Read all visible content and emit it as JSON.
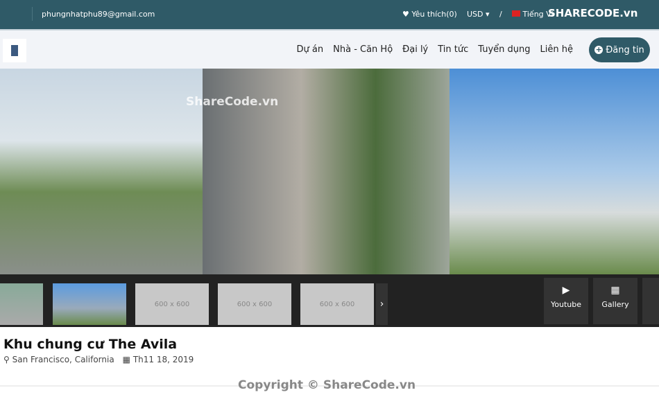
{
  "topbar": {
    "email": "phungnhatphu89@gmail.com",
    "wishlist": "Yêu thích(0)",
    "currency": "USD",
    "divider": "/",
    "language": "Tiếng Vi",
    "brand_watermark": "SHARECODE.vn"
  },
  "nav": {
    "items": [
      "Dự án",
      "Nhà - Căn Hộ",
      "Đại lý",
      "Tin tức",
      "Tuyển dụng",
      "Liên hệ"
    ],
    "post_button": "Đăng tin"
  },
  "hero": {
    "watermark": "ShareCode.vn"
  },
  "thumbnails": {
    "placeholders": [
      "600 x 600",
      "600 x 600",
      "600 x 600"
    ]
  },
  "media_buttons": [
    {
      "label": "Youtube",
      "icon": "youtube-icon"
    },
    {
      "label": "Gallery",
      "icon": "grid-icon"
    }
  ],
  "property": {
    "title": "Khu chung cư The Avila",
    "location": "San Francisco, California",
    "date": "Th11 18, 2019"
  },
  "footer": {
    "copyright": "Copyright © ShareCode.vn"
  },
  "colors": {
    "primary": "#2f5a67"
  }
}
